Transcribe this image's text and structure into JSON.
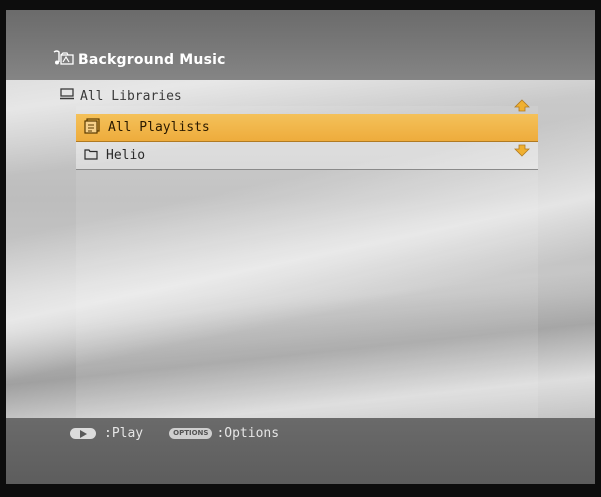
{
  "header": {
    "title": "Background Music",
    "icon": "music-folder-icon"
  },
  "breadcrumb": {
    "label": "All Libraries",
    "icon": "library-icon"
  },
  "list": {
    "items": [
      {
        "label": "All Playlists",
        "icon": "playlist-icon",
        "selected": true
      },
      {
        "label": "Helio",
        "icon": "folder-icon",
        "selected": false
      }
    ]
  },
  "footer": {
    "play_label": ":Play",
    "options_button_text": "OPTIONS",
    "options_label": ":Options"
  },
  "colors": {
    "selection": "#eeac3c",
    "arrow": "#f0b030"
  }
}
